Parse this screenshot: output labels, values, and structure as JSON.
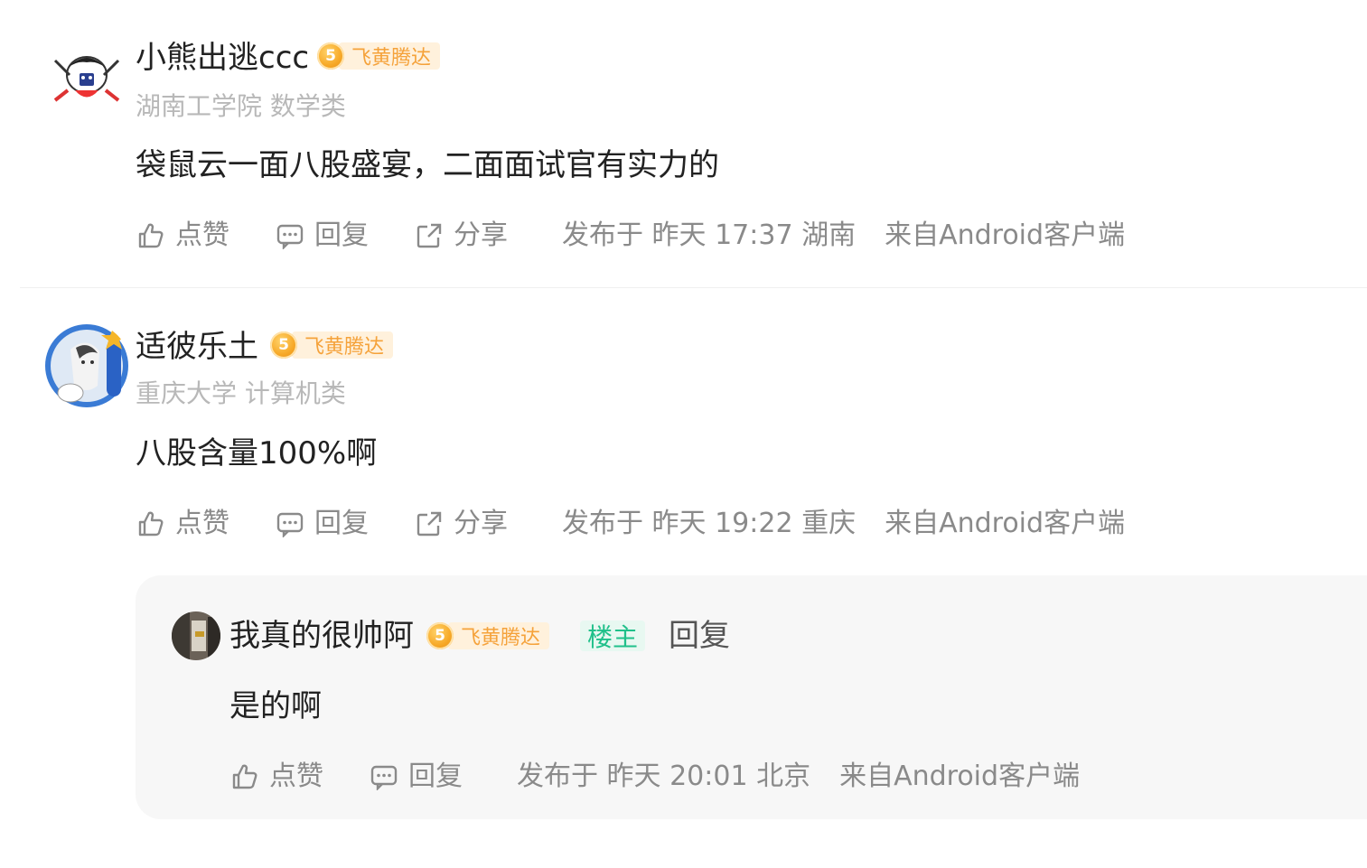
{
  "comments": [
    {
      "username": "小熊出逃ccc",
      "level": "5",
      "level_name": "飞黄腾达",
      "school": "湖南工学院 数学类",
      "text": "袋鼠云一面八股盛宴，二面面试官有实力的",
      "like_label": "点赞",
      "reply_label": "回复",
      "share_label": "分享",
      "meta": "发布于 昨天 17:37  湖南",
      "source": "来自Android客户端"
    },
    {
      "username": "适彼乐土",
      "level": "5",
      "level_name": "飞黄腾达",
      "school": "重庆大学 计算机类",
      "text": "八股含量100%啊",
      "like_label": "点赞",
      "reply_label": "回复",
      "share_label": "分享",
      "meta": "发布于 昨天 19:22  重庆",
      "source": "来自Android客户端"
    }
  ],
  "reply": {
    "username": "我真的很帅阿",
    "level": "5",
    "level_name": "飞黄腾达",
    "owner_tag": "楼主",
    "reply_word": "回复",
    "text": "是的啊",
    "like_label": "点赞",
    "reply_label": "回复",
    "meta": "发布于 昨天 20:01  北京",
    "source": "来自Android客户端"
  },
  "colors": {
    "badge_text": "#f5a23a",
    "badge_bg": "#fff1dc",
    "owner_tag": "#20c08a",
    "muted": "#8a8a8a"
  }
}
